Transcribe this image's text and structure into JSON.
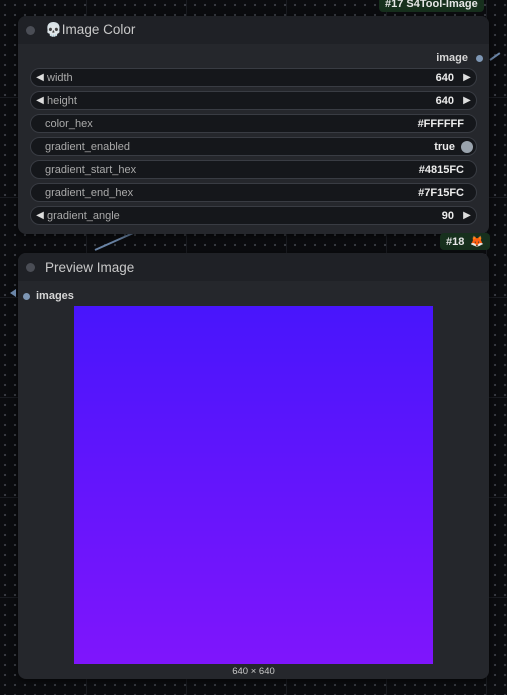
{
  "node1": {
    "badge": "#17 S4Tool-Image",
    "title": "💀Image Color",
    "output_label": "image",
    "widgets": [
      {
        "name": "width",
        "value": "640",
        "type": "number"
      },
      {
        "name": "height",
        "value": "640",
        "type": "number"
      },
      {
        "name": "color_hex",
        "value": "#FFFFFF",
        "type": "text"
      },
      {
        "name": "gradient_enabled",
        "value": "true",
        "type": "toggle"
      },
      {
        "name": "gradient_start_hex",
        "value": "#4815FC",
        "type": "text"
      },
      {
        "name": "gradient_end_hex",
        "value": "#7F15FC",
        "type": "text"
      },
      {
        "name": "gradient_angle",
        "value": "90",
        "type": "number"
      }
    ]
  },
  "node2": {
    "badge": "#18",
    "badge_icon": "fox-icon",
    "title": "Preview Image",
    "input_label": "images",
    "image_dims": "640 × 640",
    "gradient_start": "#4815FC",
    "gradient_end": "#7F15FC"
  },
  "colors": {
    "link": "#6b86a8",
    "badge_bg": "#17301d"
  }
}
